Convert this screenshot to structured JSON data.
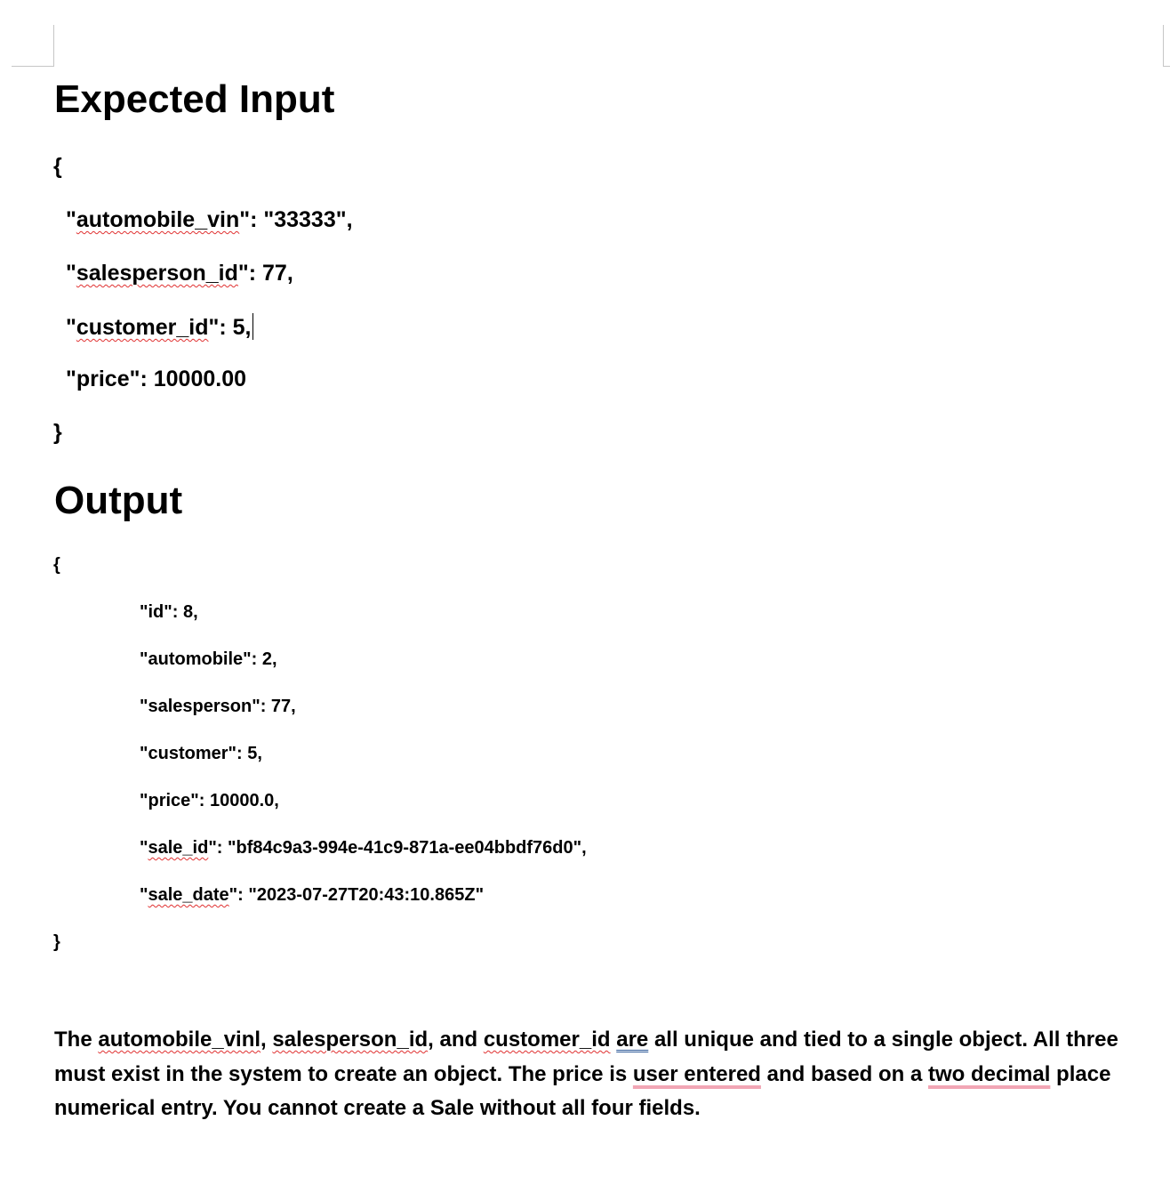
{
  "document": {
    "heading_input": "Expected Input",
    "heading_output": "Output",
    "input_json": {
      "open_brace": "{",
      "close_brace": "}",
      "automobile_vin_key": "automobile_vin",
      "automobile_vin_value": "\"33333\",",
      "salesperson_id_key": "salesperson_id",
      "salesperson_id_value": "77,",
      "customer_id_key": "customer_id",
      "customer_id_value": "5,",
      "price_line": "\"price\": 10000.00"
    },
    "output_json": {
      "open_brace": "{",
      "close_brace": "}",
      "id_line": "\"id\": 8,",
      "automobile_line": "\"automobile\": 2,",
      "salesperson_line": "\"salesperson\": 77,",
      "customer_line": "\"customer\": 5,",
      "price_line": "\"price\": 10000.0,",
      "sale_id_key": "sale_id",
      "sale_id_value": "\"bf84c9a3-994e-41c9-871a-ee04bbdf76d0\",",
      "sale_date_key": "sale_date",
      "sale_date_value": "\"2023-07-27T20:43:10.865Z\""
    },
    "paragraph": {
      "w_the": "The",
      "w_automobile_vinl": "automobile_vinl",
      "w_salesperson_id": "salesperson_id",
      "w_and": ", and",
      "w_customer_id": "customer_id",
      "w_are": "are",
      "w_rest1": "all unique and tied to a single object. All three must exist in the system to create an object. The price is",
      "w_user_entered": "user entered",
      "w_rest2": "and based on a",
      "w_two_decimal": "two decimal",
      "w_rest3": "place numerical entry. You cannot create a Sale without all four fields."
    }
  }
}
